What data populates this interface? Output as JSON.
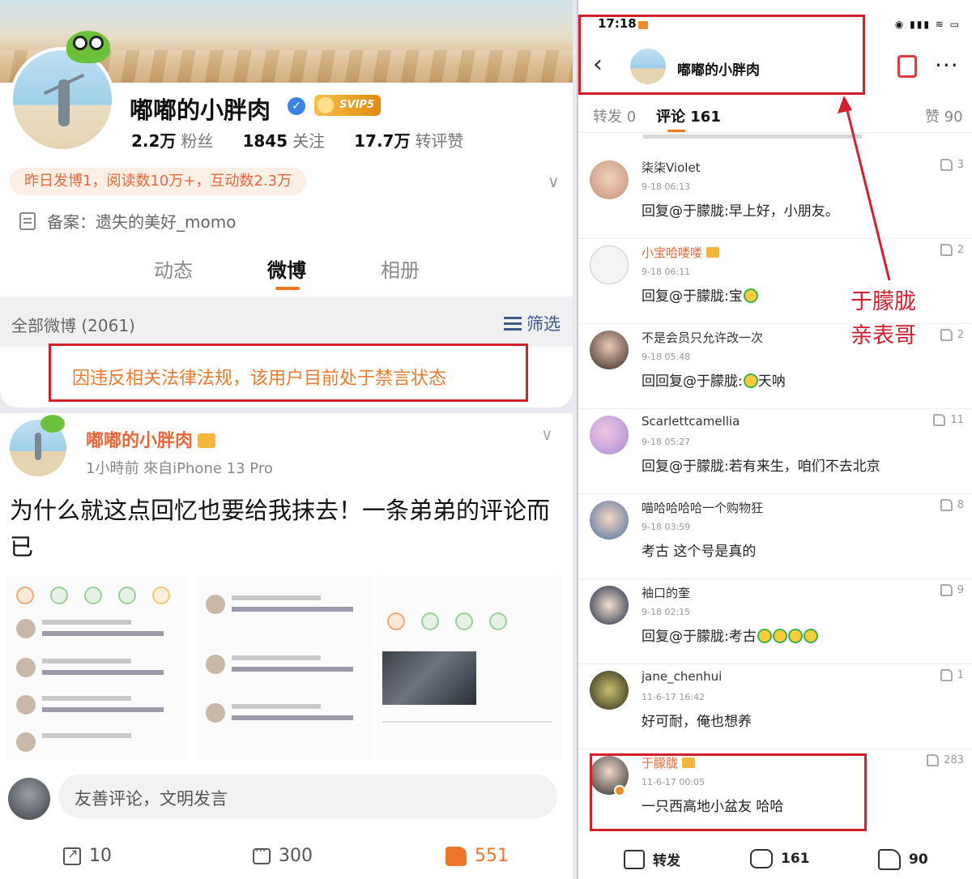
{
  "profile": {
    "name": "嘟嘟的小胖肉",
    "svip_label": "SVIP5",
    "stats": [
      {
        "num": "2.2万",
        "label": "粉丝"
      },
      {
        "num": "1845",
        "label": "关注"
      },
      {
        "num": "17.7万",
        "label": "转评赞"
      }
    ],
    "yesterday": "昨日发博1，阅读数10万+，互动数2.3万",
    "record": "备案：遗失的美好_momo",
    "tabs": [
      "动态",
      "微博",
      "相册"
    ],
    "all_weibo": "全部微博 (2061)",
    "filter_label": "筛选",
    "ban_notice": "因违反相关法律法规，该用户目前处于禁言状态"
  },
  "post": {
    "author": "嘟嘟的小胖肉",
    "meta": "1小時前  來自iPhone 13 Pro",
    "text": "为什么就这点回忆也要给我抹去！一条弟弟的评论而已",
    "comment_placeholder": "友善评论，文明发言",
    "repost_count": "10",
    "comment_count": "300",
    "like_count": "551"
  },
  "thread": {
    "time": "17:18",
    "sys_icons": "◉ ▮▮▮ ≋ ▭",
    "title": "嘟嘟的小胖肉",
    "tabs": {
      "repost": "转发 0",
      "comments": "评论 161",
      "likes": "赞 90"
    },
    "comments": [
      {
        "name": "柒柒Violet",
        "time": "9-18 06:13",
        "text": "回复@于朦胧:早上好，小朋友。",
        "likes": "3"
      },
      {
        "name": "小宝哈喽喽",
        "time": "9-18 06:11",
        "text": "回复@于朦胧:宝",
        "likes": "2"
      },
      {
        "name": "不是会员只允许改一次",
        "time": "9-18 05:48",
        "text": "回复@于朦胧:天呐",
        "likes": "2"
      },
      {
        "name": "Scarlettcamellia",
        "time": "9-18 05:27",
        "text": "回复@于朦胧:若有来生，咱们不去北京",
        "likes": "11"
      },
      {
        "name": "喵哈哈哈哈一个购物狂",
        "time": "9-18 03:59",
        "text": "考古 这个号是真的",
        "likes": "8"
      },
      {
        "name": "袖口的奎",
        "time": "9-18 02:15",
        "text": "回复@于朦胧:考古",
        "likes": "9"
      },
      {
        "name": "jane_chenhui",
        "time": "11-6-17 16:42",
        "text": "好可耐，俺也想养",
        "likes": "1"
      },
      {
        "name": "于朦胧",
        "time": "11-6-17 00:05",
        "text": "一只西高地小盆友 哈哈",
        "likes": "283"
      }
    ],
    "annotation_line1": "于朦胧",
    "annotation_line2": "亲表哥",
    "footer": {
      "repost": "转发",
      "comments": "161",
      "likes": "90"
    }
  }
}
